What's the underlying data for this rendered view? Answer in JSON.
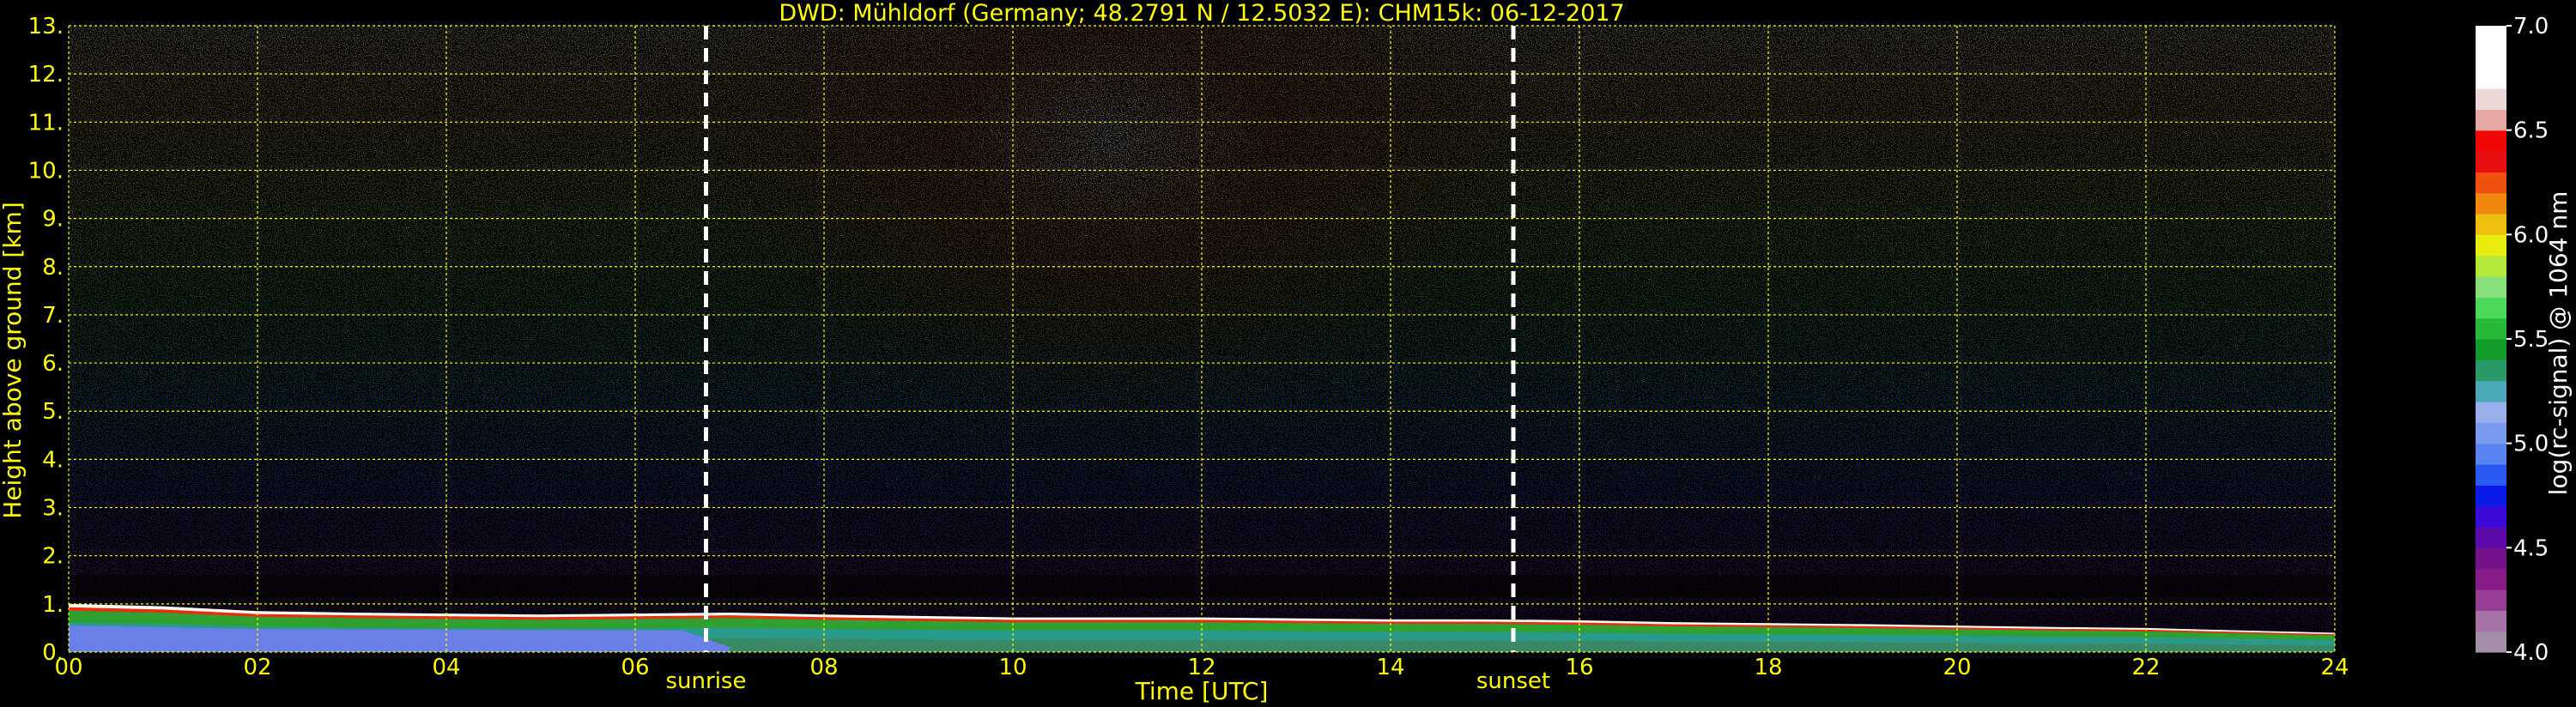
{
  "chart_data": {
    "type": "heatmap",
    "title": "DWD: Mühldorf (Germany; 48.2791 N / 12.5032 E):    CHM15k: 06-12-2017",
    "xlabel": "Time [UTC]",
    "ylabel": "Height above ground [km]",
    "xlim": [
      0,
      24
    ],
    "ylim": [
      0,
      13
    ],
    "x_ticks": [
      "00",
      "02",
      "04",
      "06",
      "08",
      "10",
      "12",
      "14",
      "16",
      "18",
      "20",
      "22",
      "24"
    ],
    "y_ticks": [
      "0.",
      "1.",
      "2.",
      "3.",
      "4.",
      "5.",
      "6.",
      "7.",
      "8.",
      "9.",
      "10.",
      "11.",
      "12.",
      "13."
    ],
    "grid": true,
    "events": [
      {
        "label": "sunrise",
        "time": 6.75
      },
      {
        "label": "sunset",
        "time": 15.3
      }
    ],
    "boundary_layer_top_km": [
      [
        0,
        1.0
      ],
      [
        1,
        0.95
      ],
      [
        2,
        0.85
      ],
      [
        3,
        0.82
      ],
      [
        4,
        0.8
      ],
      [
        5,
        0.78
      ],
      [
        6,
        0.8
      ],
      [
        7,
        0.82
      ],
      [
        8,
        0.78
      ],
      [
        9,
        0.75
      ],
      [
        10,
        0.72
      ],
      [
        11,
        0.72
      ],
      [
        12,
        0.72
      ],
      [
        13,
        0.7
      ],
      [
        14,
        0.68
      ],
      [
        15,
        0.68
      ],
      [
        16,
        0.66
      ],
      [
        17,
        0.62
      ],
      [
        18,
        0.6
      ],
      [
        19,
        0.58
      ],
      [
        20,
        0.55
      ],
      [
        21,
        0.52
      ],
      [
        22,
        0.5
      ],
      [
        23,
        0.45
      ],
      [
        24,
        0.4
      ]
    ],
    "colorbar": {
      "label": "log(rc-signal) @ 1064 nm",
      "range": [
        4.0,
        7.0
      ],
      "ticks": [
        "4.0",
        "4.5",
        "5.0",
        "5.5",
        "6.0",
        "6.5",
        "7.0"
      ],
      "colors": [
        "#a08fa6",
        "#a672a6",
        "#963e96",
        "#861a86",
        "#74128a",
        "#5c0aa8",
        "#3a0ad6",
        "#0a1ae6",
        "#2a5af0",
        "#5a82f0",
        "#7a9aee",
        "#98aeea",
        "#4aa8b8",
        "#2a9a6a",
        "#129a2a",
        "#28b83a",
        "#4cd85a",
        "#88e07a",
        "#b4e83a",
        "#e6ec10",
        "#f0c010",
        "#f08810",
        "#f05010",
        "#e81010",
        "#f00808",
        "#e8a8a8",
        "#ecd8d8",
        "#ffffff",
        "#ffffff",
        "#ffffff"
      ]
    }
  }
}
